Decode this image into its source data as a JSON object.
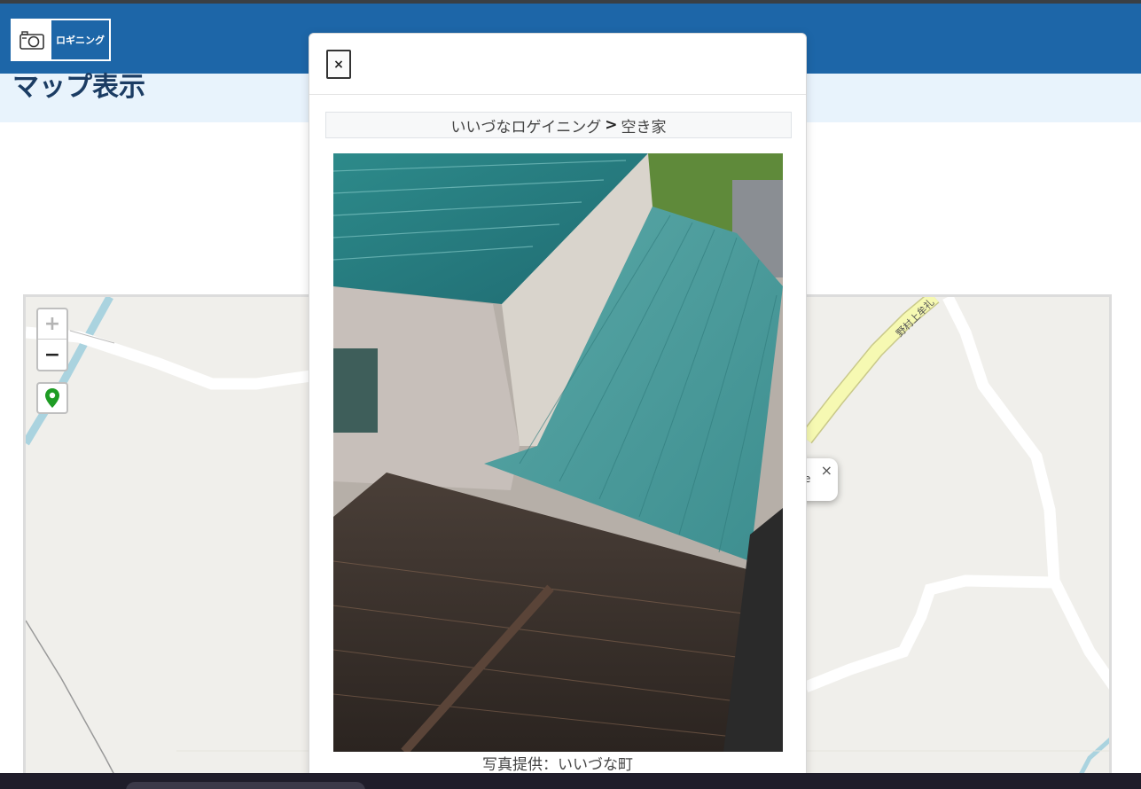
{
  "header": {
    "logo_label": "ロギニング",
    "logo_icon": "camera-icon",
    "brand_color": "#1d66a8"
  },
  "page": {
    "title": "マップ表示"
  },
  "map": {
    "zoom_in_label": "+",
    "zoom_out_label": "−",
    "locate_icon": "map-marker-icon",
    "road_label": "野村上牟礼",
    "popup": {
      "close_label": "×",
      "text_fragment": "e"
    }
  },
  "modal": {
    "close_label": "×",
    "breadcrumb": {
      "parent": "いいづなロゲイニング",
      "separator": ">",
      "current": "空き家"
    },
    "photo_description_icon": "photo",
    "credit": "写真提供：いいづな町"
  }
}
